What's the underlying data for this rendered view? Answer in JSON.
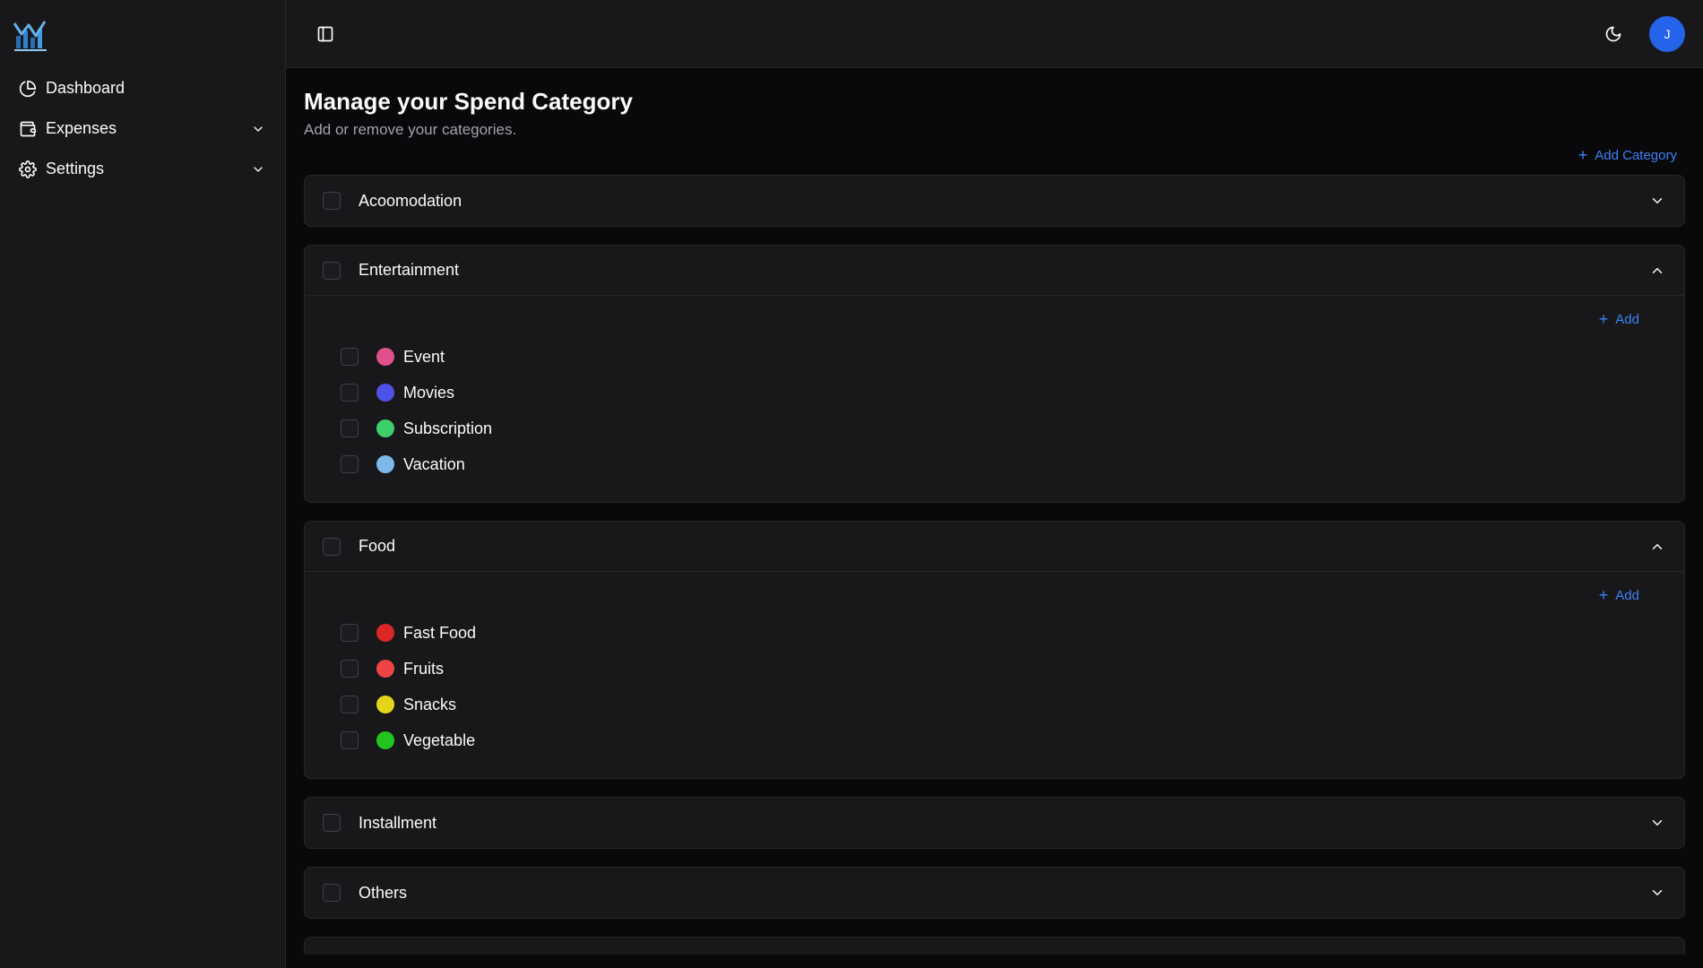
{
  "sidebar": {
    "logo_icon": "chart-logo-icon",
    "items": [
      {
        "label": "Dashboard",
        "icon": "pie-chart-icon",
        "expandable": false
      },
      {
        "label": "Expenses",
        "icon": "wallet-icon",
        "expandable": true
      },
      {
        "label": "Settings",
        "icon": "gear-icon",
        "expandable": true
      }
    ]
  },
  "topbar": {
    "toggle_icon": "sidebar-toggle-icon",
    "theme_icon": "moon-icon",
    "avatar_initial": "J",
    "avatar_color": "#2563eb"
  },
  "page": {
    "title": "Manage your Spend Category",
    "subtitle": "Add or remove your categories.",
    "add_category_label": "Add Category",
    "add_label": "Add"
  },
  "categories": [
    {
      "name": "Acoomodation",
      "expanded": false,
      "items": []
    },
    {
      "name": "Entertainment",
      "expanded": true,
      "items": [
        {
          "label": "Event",
          "color": "#e0508a"
        },
        {
          "label": "Movies",
          "color": "#4f52e6"
        },
        {
          "label": "Subscription",
          "color": "#3ecf6a"
        },
        {
          "label": "Vacation",
          "color": "#7db8ea"
        }
      ]
    },
    {
      "name": "Food",
      "expanded": true,
      "items": [
        {
          "label": "Fast Food",
          "color": "#dc2626"
        },
        {
          "label": "Fruits",
          "color": "#ef4444"
        },
        {
          "label": "Snacks",
          "color": "#e4d51c"
        },
        {
          "label": "Vegetable",
          "color": "#22c51e"
        }
      ]
    },
    {
      "name": "Installment",
      "expanded": false,
      "items": []
    },
    {
      "name": "Others",
      "expanded": false,
      "items": []
    }
  ],
  "colors": {
    "accent": "#3b82f6",
    "background": "#09090b",
    "panel": "#18181b",
    "border": "#27272a"
  }
}
